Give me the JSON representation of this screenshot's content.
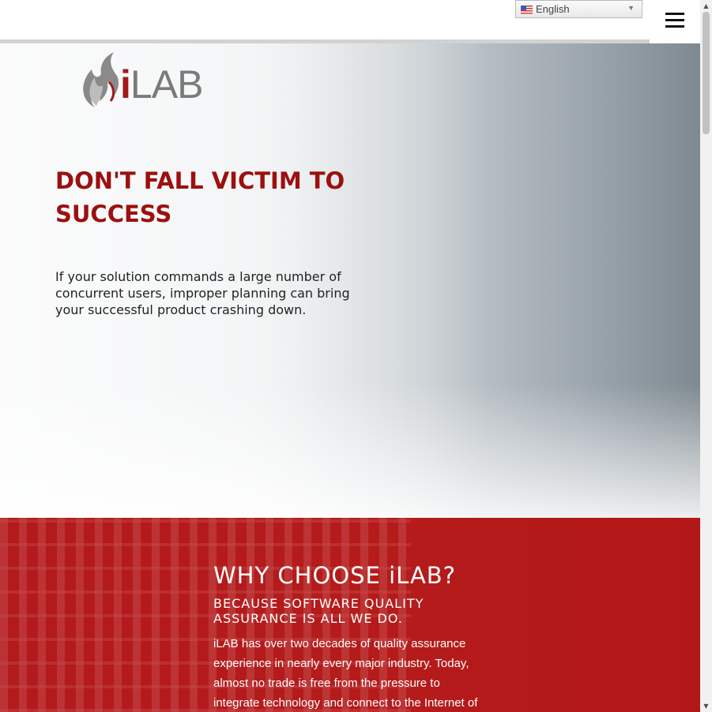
{
  "language": {
    "selected": "English",
    "flag_icon": "us-flag-icon"
  },
  "nav": {
    "menu_icon": "hamburger-menu-icon"
  },
  "logo": {
    "alt": "iLAB",
    "accent": "#a11a1a"
  },
  "hero": {
    "headline": "DON'T FALL VICTIM TO SUCCESS",
    "text": "If your solution commands a large number of concurrent users, improper planning can bring your successful product crashing down.",
    "headline_color": "#9c1010"
  },
  "why": {
    "title": "WHY CHOOSE iLAB?",
    "subtitle": "BECAUSE SOFTWARE QUALITY ASSURANCE IS ALL WE DO.",
    "body": "iLAB has over two decades of quality assurance experience in nearly every major industry. Today, almost no trade is free from the pressure to integrate technology and connect to the Internet of Things. We",
    "background_color": "#b31a1c"
  }
}
